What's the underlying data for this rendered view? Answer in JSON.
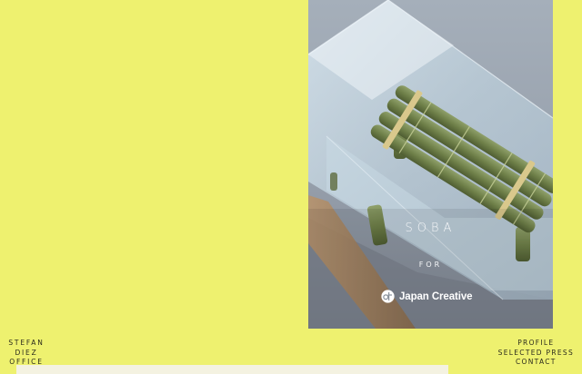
{
  "hero": {
    "title": "SOBA",
    "for_label": "FOR",
    "partner": "Japan Creative",
    "partner_logo_icon": "japan-creative-logo-icon"
  },
  "brand": {
    "lines": [
      "STEFAN",
      "DIEZ",
      "OFFICE"
    ]
  },
  "nav": {
    "items": [
      {
        "label": "PROFILE"
      },
      {
        "label": "SELECTED PRESS"
      },
      {
        "label": "CONTACT"
      }
    ]
  },
  "colors": {
    "background": "#eef16f",
    "strip": "#f4f2e1"
  }
}
